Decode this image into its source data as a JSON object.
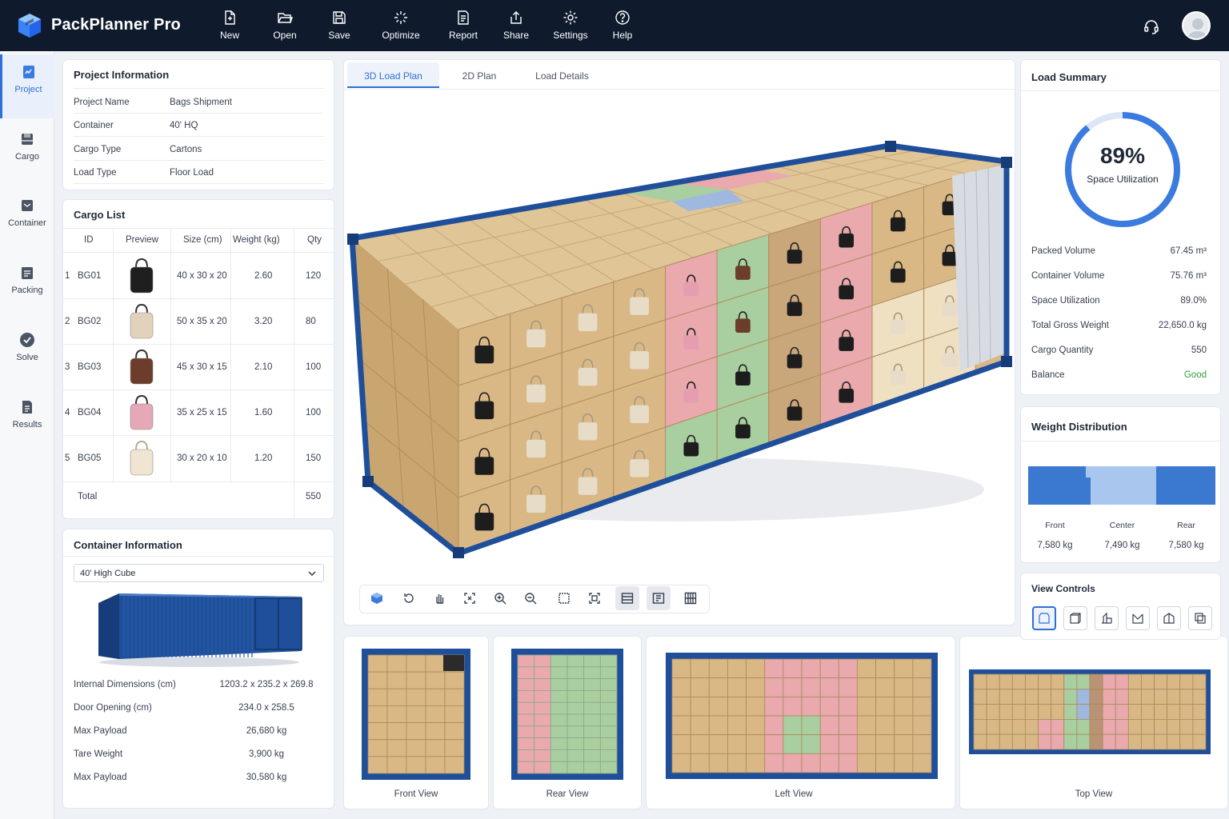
{
  "app": {
    "title": "PackPlanner Pro"
  },
  "toolbar": [
    {
      "label": "New",
      "icon": "new-file-icon"
    },
    {
      "label": "Open",
      "icon": "folder-open-icon"
    },
    {
      "label": "Save",
      "icon": "save-icon"
    },
    {
      "label": "Optimize",
      "icon": "optimize-icon"
    },
    {
      "label": "Report",
      "icon": "report-icon"
    },
    {
      "label": "Share",
      "icon": "share-icon"
    },
    {
      "label": "Settings",
      "icon": "gear-icon"
    },
    {
      "label": "Help",
      "icon": "help-icon"
    }
  ],
  "sidebar": [
    {
      "label": "Project",
      "icon": "project-icon",
      "active": true
    },
    {
      "label": "Cargo",
      "icon": "cargo-icon"
    },
    {
      "label": "Container",
      "icon": "container-icon"
    },
    {
      "label": "Packing",
      "icon": "packing-icon"
    },
    {
      "label": "Solve",
      "icon": "solve-check-icon"
    },
    {
      "label": "Results",
      "icon": "results-icon"
    }
  ],
  "project": {
    "title": "Project Information",
    "rows": [
      {
        "label": "Project Name",
        "value": "Bags Shipment"
      },
      {
        "label": "Container",
        "value": "40' HQ"
      },
      {
        "label": "Cargo Type",
        "value": "Cartons"
      },
      {
        "label": "Load Type",
        "value": "Floor Load"
      }
    ]
  },
  "cargo": {
    "title": "Cargo List",
    "headers": [
      "ID",
      "Preview",
      "Size (cm)",
      "Weight (kg)",
      "Qty"
    ],
    "rows": [
      {
        "n": "1",
        "id": "BG01",
        "size": "40 x 30 x 20",
        "weight": "2.60",
        "qty": "120",
        "color": "#1f1f1f"
      },
      {
        "n": "2",
        "id": "BG02",
        "size": "50 x 35 x 20",
        "weight": "3.20",
        "qty": "80",
        "color": "#e3d2bb"
      },
      {
        "n": "3",
        "id": "BG03",
        "size": "45 x 30 x 15",
        "weight": "2.10",
        "qty": "100",
        "color": "#6b3d2a"
      },
      {
        "n": "4",
        "id": "BG04",
        "size": "35 x 25 x 15",
        "weight": "1.60",
        "qty": "100",
        "color": "#e6a7b7"
      },
      {
        "n": "5",
        "id": "BG05",
        "size": "30 x 20 x 10",
        "weight": "1.20",
        "qty": "150",
        "color": "#efe5d0"
      }
    ],
    "total_label": "Total",
    "total_qty": "550"
  },
  "container_info": {
    "title": "Container Information",
    "select_value": "40' High Cube",
    "rows": [
      {
        "label": "Internal Dimensions (cm)",
        "value": "1203.2 x 235.2 x 269.8"
      },
      {
        "label": "Door Opening (cm)",
        "value": "234.0 x 258.5"
      },
      {
        "label": "Max Payload",
        "value": "26,680 kg"
      },
      {
        "label": "Tare Weight",
        "value": "3,900 kg"
      },
      {
        "label": "Max Payload",
        "value": "30,580 kg"
      }
    ]
  },
  "tabs": [
    "3D Load Plan",
    "2D Plan",
    "Load Details"
  ],
  "view_thumbs": [
    "Front View",
    "Rear View",
    "Left View",
    "Top View"
  ],
  "summary": {
    "title": "Load Summary",
    "percent": "89%",
    "percent_label": "Space Utilization",
    "utilization": 0.89,
    "rows": [
      {
        "label": "Packed Volume",
        "value": "67.45 m³"
      },
      {
        "label": "Container Volume",
        "value": "75.76 m³"
      },
      {
        "label": "Space Utilization",
        "value": "89.0%"
      },
      {
        "label": "Total Gross Weight",
        "value": "22,650.0 kg"
      },
      {
        "label": "Cargo Quantity",
        "value": "550"
      },
      {
        "label": "Balance",
        "value": "Good"
      }
    ],
    "good_color": "#2e9d3c"
  },
  "weight": {
    "title": "Weight Distribution",
    "sections": [
      {
        "label": "Front",
        "value": "7,580 kg"
      },
      {
        "label": "Center",
        "value": "7,490 kg"
      },
      {
        "label": "Rear",
        "value": "7,580 kg"
      }
    ]
  },
  "view_controls": {
    "title": "View Controls"
  },
  "colors": {
    "accent": "#2f6fd6",
    "navy": "#0f1b2d",
    "container": "#1f4f9a",
    "carton": "#d9b886",
    "pink": "#e9a9ad",
    "green": "#a9cfa0"
  }
}
